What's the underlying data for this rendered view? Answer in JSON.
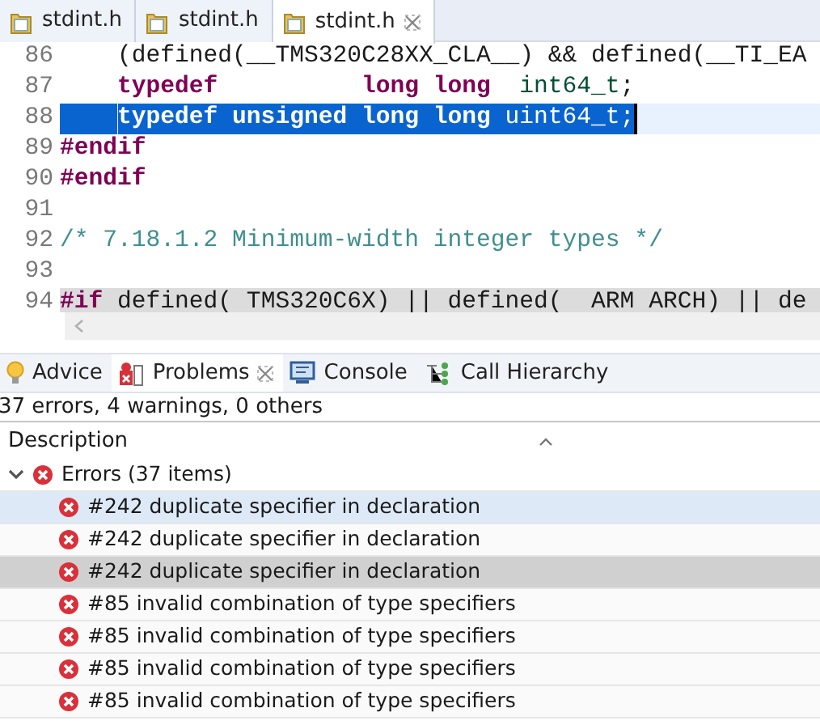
{
  "editor_tabs": [
    {
      "label": "stdint.h",
      "selected": false
    },
    {
      "label": "stdint.h",
      "selected": false
    },
    {
      "label": "stdint.h",
      "selected": true
    }
  ],
  "code_lines": [
    {
      "number": "86",
      "selected": false,
      "marked": false,
      "indented": true,
      "tokens": [
        {
          "kind": "plain",
          "text": "(defined(__TMS320C28XX_CLA__) && defined(__TI_EA"
        }
      ]
    },
    {
      "number": "87",
      "selected": false,
      "marked": false,
      "indented": true,
      "tokens": [
        {
          "kind": "keyword",
          "text": "typedef          long long  "
        },
        {
          "kind": "type",
          "text": "int64_t"
        },
        {
          "kind": "plain",
          "text": ";"
        }
      ]
    },
    {
      "number": "88",
      "selected": true,
      "marked": false,
      "indented": true,
      "tokens": [
        {
          "kind": "keyword",
          "text": "typedef unsigned long long "
        },
        {
          "kind": "type",
          "text": "uint64_t"
        },
        {
          "kind": "plain",
          "text": ";"
        }
      ]
    },
    {
      "number": "89",
      "selected": false,
      "marked": false,
      "indented": false,
      "tokens": [
        {
          "kind": "keyword",
          "text": "#endif"
        }
      ]
    },
    {
      "number": "90",
      "selected": false,
      "marked": false,
      "indented": false,
      "tokens": [
        {
          "kind": "keyword",
          "text": "#endif"
        }
      ]
    },
    {
      "number": "91",
      "selected": false,
      "marked": false
    },
    {
      "number": "92",
      "selected": false,
      "marked": false,
      "indented": false,
      "tokens": [
        {
          "kind": "comment",
          "text": "/* 7.18.1.2 Minimum-width integer types */"
        }
      ]
    },
    {
      "number": "93",
      "selected": false,
      "marked": false
    },
    {
      "number": "94",
      "selected": false,
      "marked": true,
      "indented": false,
      "tokens": [
        {
          "kind": "keyword",
          "text": "#if"
        },
        {
          "kind": "plain",
          "text": " defined( TMS320C6X) || defined(  ARM ARCH) || de"
        }
      ]
    }
  ],
  "view_tabs": [
    {
      "label": "Advice",
      "kind": "advice",
      "selected": false
    },
    {
      "label": "Problems",
      "kind": "problems",
      "selected": true
    },
    {
      "label": "Console",
      "kind": "console",
      "selected": false
    },
    {
      "label": "Call Hierarchy",
      "kind": "hierarchy",
      "selected": false
    }
  ],
  "summary": "37 errors, 4 warnings, 0 others",
  "column": "Description",
  "tree": {
    "label": "Errors (37 items)",
    "expanded": true,
    "children": [
      {
        "label": "#242 duplicate specifier in declaration",
        "selected": true,
        "hovered": false
      },
      {
        "label": "#242 duplicate specifier in declaration",
        "selected": false,
        "hovered": false
      },
      {
        "label": "#242 duplicate specifier in declaration",
        "selected": false,
        "hovered": true
      },
      {
        "label": "#85 invalid combination of type specifiers",
        "selected": false,
        "hovered": false
      },
      {
        "label": "#85 invalid combination of type specifiers",
        "selected": false,
        "hovered": false
      },
      {
        "label": "#85 invalid combination of type specifiers",
        "selected": false,
        "hovered": false
      },
      {
        "label": "#85 invalid combination of type specifiers",
        "selected": false,
        "hovered": false
      }
    ]
  }
}
